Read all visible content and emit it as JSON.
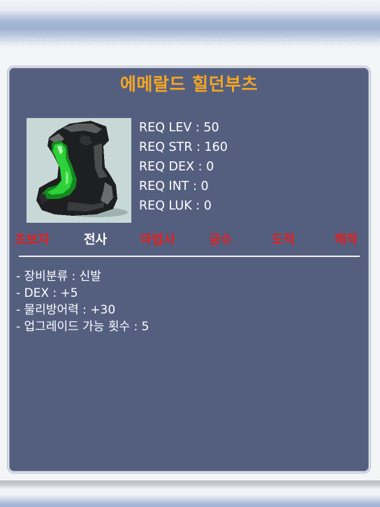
{
  "item": {
    "name": "에메랄드 힐던부츠",
    "icon": "emerald-boots-icon"
  },
  "requirements": [
    {
      "label": "REQ LEV",
      "value": "50",
      "text": "REQ LEV : 50"
    },
    {
      "label": "REQ STR",
      "value": "160",
      "text": "REQ STR : 160"
    },
    {
      "label": "REQ DEX",
      "value": "0",
      "text": "REQ DEX : 0"
    },
    {
      "label": "REQ INT",
      "value": "0",
      "text": "REQ INT : 0"
    },
    {
      "label": "REQ LUK",
      "value": "0",
      "text": "REQ LUK : 0"
    }
  ],
  "jobs": [
    {
      "name": "초보자",
      "color": "#e0201f"
    },
    {
      "name": "전사",
      "color": "#ffffff"
    },
    {
      "name": "마법사",
      "color": "#e0201f"
    },
    {
      "name": "궁수",
      "color": "#e0201f"
    },
    {
      "name": "도적",
      "color": "#e0201f"
    },
    {
      "name": "해적",
      "color": "#e0201f"
    }
  ],
  "details": [
    "- 장비분류 : 신발",
    "- DEX : +5",
    "- 물리방어력 : +30",
    "- 업그레이드 가능 횟수 : 5"
  ],
  "colors": {
    "tooltip_bg": "#545f80",
    "item_name": "#f5a623",
    "unavailable_job": "#e0201f",
    "available_job": "#ffffff"
  }
}
